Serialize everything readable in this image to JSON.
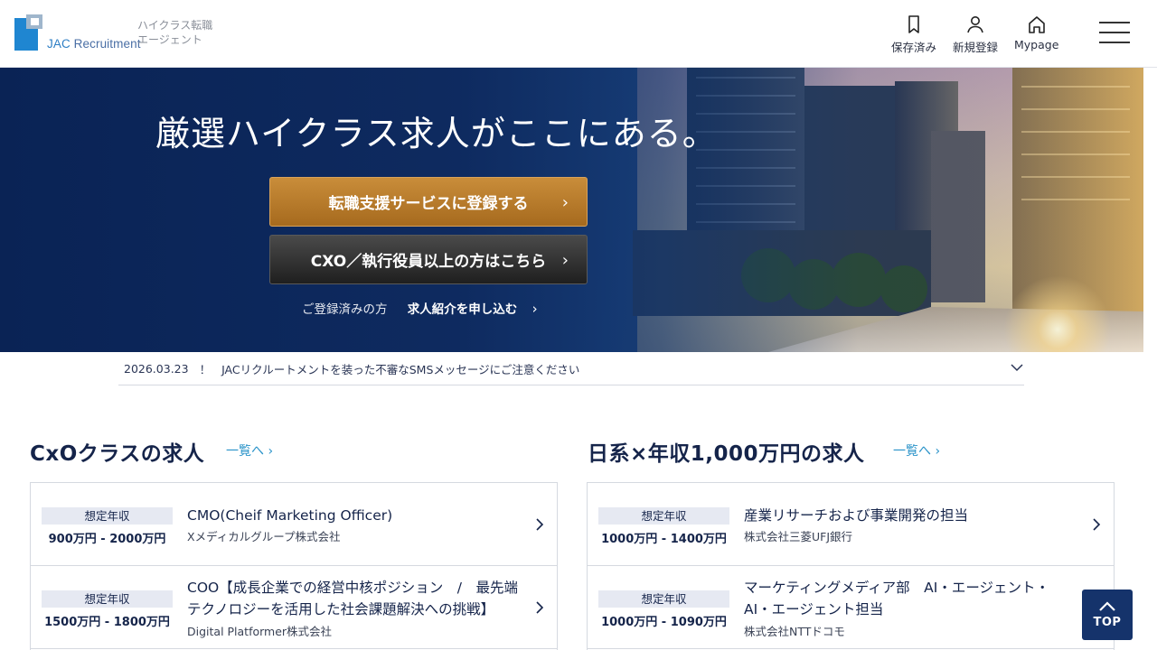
{
  "header": {
    "logo_prefix": "JAC",
    "logo_text": "Recruitment",
    "tagline": "ハイクラス転職\nエージェント",
    "nav": [
      {
        "label": "保存済み",
        "icon": "bookmark-icon"
      },
      {
        "label": "新規登録",
        "icon": "user-icon"
      },
      {
        "label": "Mypage",
        "icon": "home-icon"
      }
    ],
    "menu_icon": "hamburger-icon"
  },
  "hero": {
    "title": "厳選ハイクラス求人がここにある。",
    "cta_primary": "転職支援サービスに登録する",
    "cta_secondary": "CXO／執行役員以上の方はこちら",
    "registered_lead": "ご登録済みの方",
    "registered_link": "求人紹介を申し込む"
  },
  "notice": {
    "date": "2026.03.23",
    "mark": "！",
    "text": "JACリクルートメントを装った不審なSMSメッセージにご注意ください"
  },
  "sections": [
    {
      "title": "CxOクラスの求人",
      "link": "一覧へ",
      "jobs": [
        {
          "badge": "想定年収",
          "salary": "900万円 - 2000万円",
          "title": "CMO(Cheif Marketing Officer)",
          "company": "Xメディカルグループ株式会社"
        },
        {
          "badge": "想定年収",
          "salary": "1500万円 - 1800万円",
          "title": "COO【成長企業での経営中核ポジション　/　最先端テクノロジーを活用した社会課題解決への挑戦】",
          "company": "Digital Platformer株式会社"
        }
      ]
    },
    {
      "title": "日系×年収1,000万円の求人",
      "link": "一覧へ",
      "jobs": [
        {
          "badge": "想定年収",
          "salary": "1000万円 - 1400万円",
          "title": "産業リサーチおよび事業開発の担当",
          "company": "株式会社三菱UFJ銀行"
        },
        {
          "badge": "想定年収",
          "salary": "1000万円 - 1090万円",
          "title": "マーケティングメディア部　AI・エージェント・AI・エージェント担当",
          "company": "株式会社NTTドコモ"
        }
      ]
    }
  ],
  "top_button": {
    "label": "TOP"
  },
  "colors": {
    "navy": "#15244a",
    "accent_link": "#2a93c9",
    "cta_gold": "#b67a2a",
    "top_btn": "#15336b"
  }
}
